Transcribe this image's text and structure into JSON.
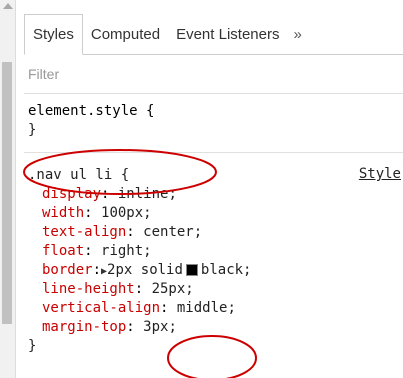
{
  "tabs": [
    {
      "label": "Styles"
    },
    {
      "label": "Computed"
    },
    {
      "label": "Event Listeners"
    }
  ],
  "more_glyph": "»",
  "filter_placeholder": "Filter",
  "element_style": {
    "selector": "element.style {",
    "close": "}"
  },
  "rule": {
    "selector": ".nav ul li {",
    "source_link": "Style",
    "declarations": [
      {
        "name": "display",
        "value": "inline;"
      },
      {
        "name": "width",
        "value": "100px;"
      },
      {
        "name": "text-align",
        "value": "center;"
      },
      {
        "name": "float",
        "value": "right;"
      },
      {
        "name": "border",
        "value_pre": "2px solid",
        "value_post": "black;"
      },
      {
        "name": "line-height",
        "value": "25px;"
      },
      {
        "name": "vertical-align",
        "value": "middle;"
      },
      {
        "name": "margin-top",
        "value": "3px;"
      }
    ],
    "close": "}"
  },
  "colors": {
    "property_name": "#c80000",
    "annotation_circle": "#cc0000",
    "swatch": "#000000"
  }
}
